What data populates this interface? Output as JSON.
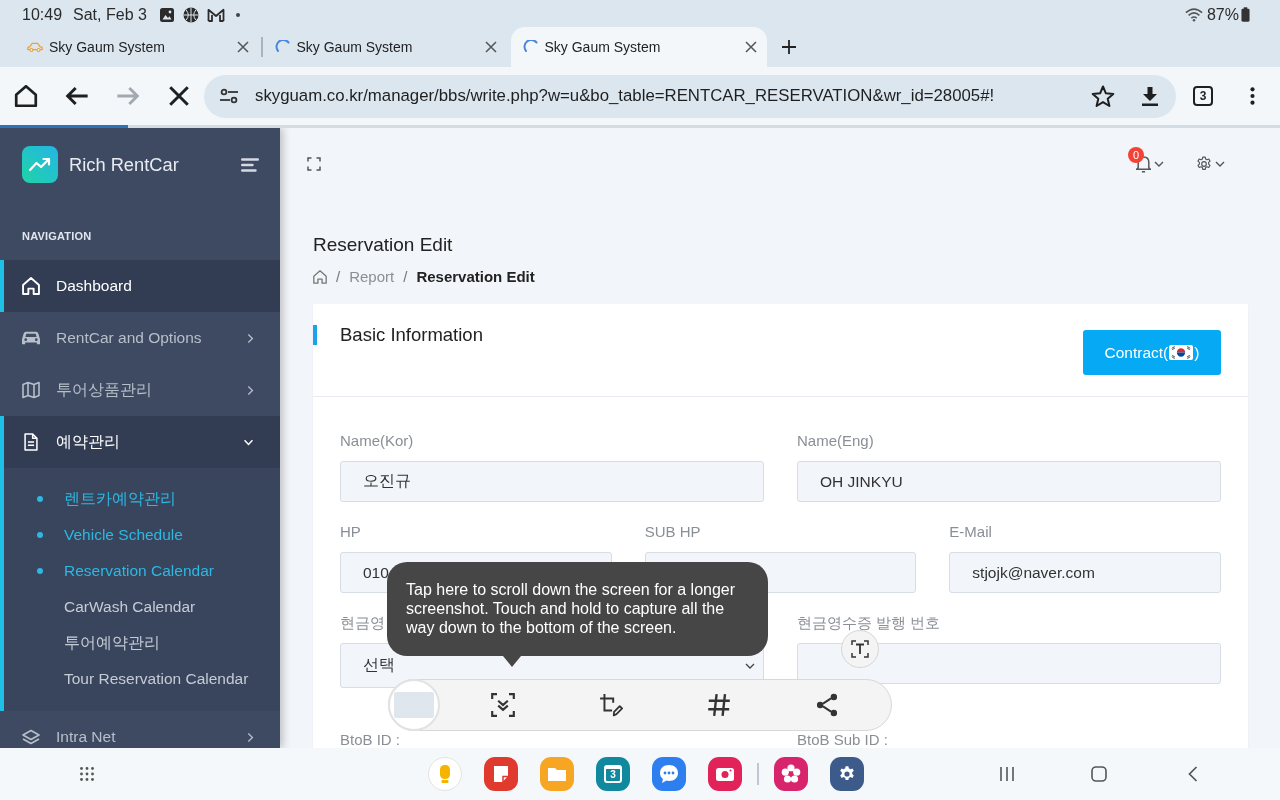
{
  "status_bar": {
    "time": "10:49",
    "date": "Sat, Feb 3",
    "notifications": [
      {
        "kind": "gallery"
      },
      {
        "kind": "basketball"
      },
      {
        "kind": "gmail"
      },
      {
        "kind": "more"
      }
    ],
    "battery": "87%"
  },
  "browser": {
    "tabs": [
      {
        "title": "Sky Gaum System",
        "loading": false,
        "selected": false
      },
      {
        "title": "Sky Gaum System",
        "loading": true,
        "selected": false
      },
      {
        "title": "Sky Gaum System",
        "loading": true,
        "selected": true
      }
    ],
    "nav_buttons": [
      {
        "kind": "home",
        "disabled": false
      },
      {
        "kind": "back",
        "disabled": false
      },
      {
        "kind": "forward",
        "disabled": true
      },
      {
        "kind": "stop",
        "disabled": false
      }
    ],
    "url": "skyguam.co.kr/manager/bbs/write.php?w=u&bo_table=RENTCAR_RESERVATION&wr_id=28005#!",
    "bookmarked": false,
    "tab_count": "3",
    "loading": {
      "level": 0.1
    }
  },
  "sidebar": {
    "brand": "Rich RentCar",
    "section": "NAVIGATION",
    "items": [
      {
        "label": "Dashboard",
        "kind": "link",
        "selected": true
      },
      {
        "label": "RentCar and Options",
        "kind": "menu",
        "selected": false,
        "expanded": false
      },
      {
        "label": "투어상품관리",
        "kind": "menu",
        "selected": false,
        "expanded": false
      },
      {
        "label": "예약관리",
        "kind": "menu",
        "selected": true,
        "expanded": true,
        "children": [
          {
            "label": "렌트카예약관리",
            "selected": true
          },
          {
            "label": "Vehicle Schedule",
            "selected": true
          },
          {
            "label": "Reservation Calendar",
            "selected": true
          },
          {
            "label": "CarWash Calendar",
            "selected": false
          },
          {
            "label": "투어예약관리",
            "selected": false
          },
          {
            "label": "Tour Reservation Calendar",
            "selected": false
          }
        ]
      },
      {
        "label": "Intra Net",
        "kind": "menu",
        "selected": false,
        "expanded": false
      }
    ]
  },
  "topbar": {
    "notification_count": "0"
  },
  "page": {
    "title": "Reservation Edit",
    "breadcrumb": {
      "separator": "/",
      "items": [
        {
          "label": "Report",
          "current": false
        },
        {
          "label": "Reservation Edit",
          "current": true
        }
      ]
    }
  },
  "card": {
    "title": "Basic Information",
    "contract_button": {
      "label_open": "Contract(",
      "label_close": ")"
    },
    "rows": [
      [
        {
          "label": "Name(Kor)",
          "kind": "text",
          "value": "오진규"
        },
        {
          "label": "Name(Eng)",
          "kind": "text",
          "value": "OH JINKYU"
        }
      ],
      [
        {
          "label": "HP",
          "kind": "text",
          "value": "010"
        },
        {
          "label": "SUB HP",
          "kind": "text"
        },
        {
          "label": "E-Mail",
          "kind": "text",
          "value": "stjojk@naver.com"
        }
      ],
      [
        {
          "label": "현금영",
          "kind": "select",
          "value": "선택"
        },
        {
          "label": "현금영수증 발행 번호",
          "kind": "text"
        }
      ],
      [
        {
          "label": "BtoB ID :",
          "kind": "label"
        },
        {
          "label": "BtoB Sub ID :",
          "kind": "label"
        }
      ]
    ]
  },
  "screenshot_toolbar": {
    "tooltip": "Tap here to scroll down the screen for a longer screenshot. Touch and hold to capture all the way down to the bottom of the screen.",
    "tools": [
      {
        "kind": "scroll_capture"
      },
      {
        "kind": "crop_edit"
      },
      {
        "kind": "tag"
      },
      {
        "kind": "share"
      }
    ]
  },
  "nav_bar": {
    "apps": [
      {
        "kind": "keep"
      },
      {
        "kind": "notes"
      },
      {
        "kind": "files"
      },
      {
        "kind": "calendar",
        "text": "3"
      },
      {
        "kind": "messages"
      },
      {
        "kind": "camera"
      }
    ],
    "recent_apps": [
      {
        "kind": "flower"
      },
      {
        "kind": "settings"
      }
    ]
  }
}
